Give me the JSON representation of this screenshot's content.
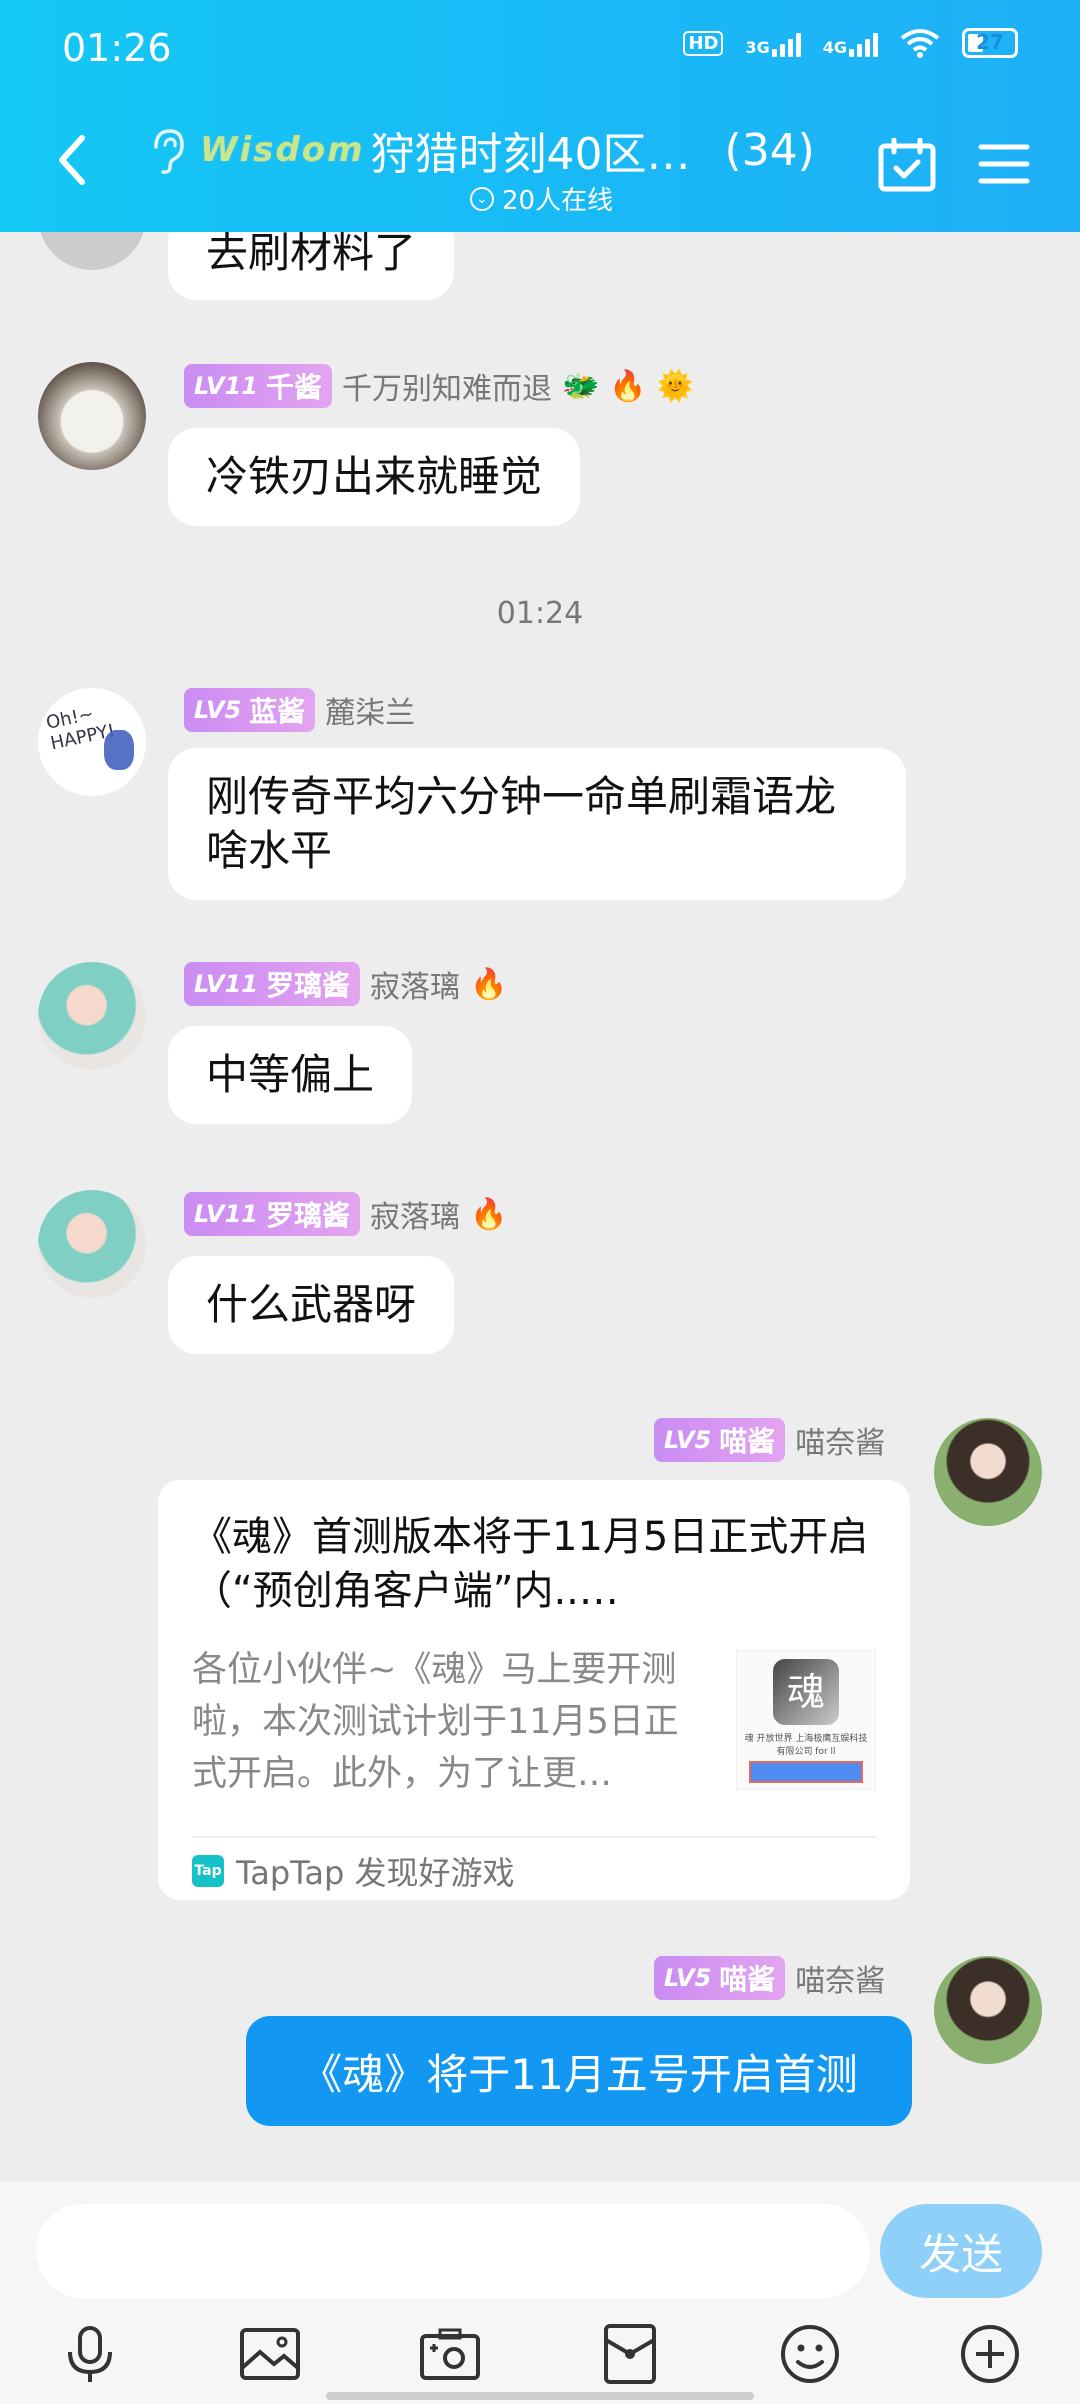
{
  "status_bar": {
    "time": "01:26",
    "hd_label": "HD",
    "net_3g": "3G",
    "net_4g": "4G",
    "battery": "27"
  },
  "header": {
    "logo_text": "Wisdom",
    "title": "狩猎时刻40区…",
    "member_count": "(34)",
    "online_text": "20人在线"
  },
  "messages": {
    "m0_text": "去刷材料了",
    "m1": {
      "level": "LV11",
      "badge": "千酱",
      "name": "千万别知难而退",
      "text": "冷铁刃出来就睡觉"
    },
    "time1": "01:24",
    "m2": {
      "level": "LV5",
      "badge": "蓝酱",
      "name": "麓柒兰",
      "text": "刚传奇平均六分钟一命单刷霜语龙啥水平"
    },
    "m3": {
      "level": "LV11",
      "badge": "罗璃酱",
      "name": "寂落璃",
      "text": "中等偏上"
    },
    "m4": {
      "level": "LV11",
      "badge": "罗璃酱",
      "name": "寂落璃",
      "text": "什么武器呀"
    },
    "m5": {
      "level": "LV5",
      "badge": "喵酱",
      "name": "喵奈酱",
      "card_title": "《魂》首测版本将于11月5日正式开启（“预创角客户端”内..…",
      "card_desc": "各位小伙伴~《魂》马上要开测啦，本次测试计划于11月5日正式开启。此外，为了让更…",
      "card_source": "TapTap 发现好游戏",
      "tap_logo": "Tap",
      "thumb_char": "魂",
      "thumb_text": "魂 开放世界 上海极鹰互娱科技有限公司 for ll"
    },
    "m6": {
      "level": "LV5",
      "badge": "喵酱",
      "name": "喵奈酱",
      "text": "《魂》将于11月五号开启首测"
    }
  },
  "input": {
    "placeholder": "",
    "send_label": "发送"
  },
  "colors": {
    "header": "#19b9f6",
    "badge": "#c98cf2",
    "my_bubble": "#1298f2",
    "send": "#8fd0f8"
  }
}
